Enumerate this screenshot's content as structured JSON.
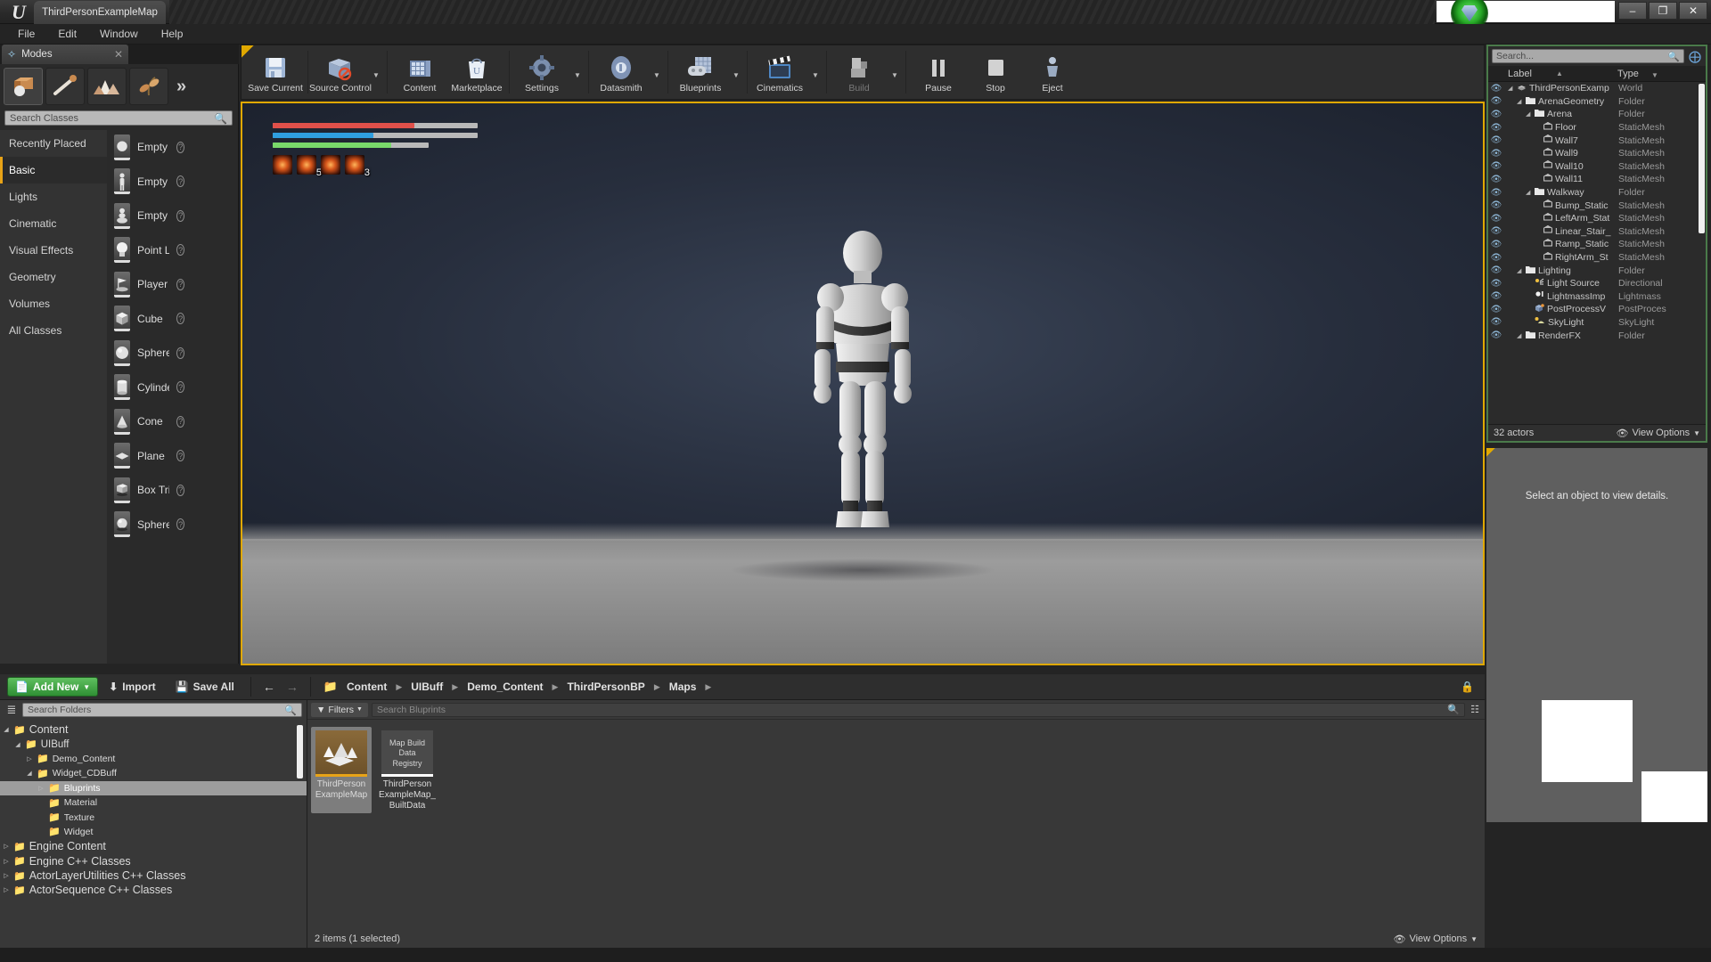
{
  "window": {
    "title": "ThirdPersonExampleMap",
    "logo_icon": "unreal-logo-icon",
    "minimize_label": "–",
    "maximize_label": "❐",
    "close_label": "✕"
  },
  "menubar": {
    "items": [
      "File",
      "Edit",
      "Window",
      "Help"
    ]
  },
  "modes": {
    "tab_label": "Modes",
    "tab_icon": "modes-icon",
    "close_label": "✕",
    "more_label": "»",
    "mode_icons": [
      "place-mode-icon",
      "paint-mode-icon",
      "landscape-mode-icon",
      "foliage-mode-icon"
    ],
    "search_placeholder": "Search Classes",
    "search_icon": "search-icon",
    "categories": [
      "Recently Placed",
      "Basic",
      "Lights",
      "Cinematic",
      "Visual Effects",
      "Geometry",
      "Volumes",
      "All Classes"
    ],
    "active_category": "Basic",
    "classes": [
      {
        "label": "Empty Acto",
        "icon": "empty-actor-icon"
      },
      {
        "label": "Empty Char",
        "icon": "empty-character-icon"
      },
      {
        "label": "Empty Paw",
        "icon": "empty-pawn-icon"
      },
      {
        "label": "Point Light",
        "icon": "point-light-icon"
      },
      {
        "label": "Player Star",
        "icon": "player-start-icon"
      },
      {
        "label": "Cube",
        "icon": "cube-icon"
      },
      {
        "label": "Sphere",
        "icon": "sphere-icon"
      },
      {
        "label": "Cylinder",
        "icon": "cylinder-icon"
      },
      {
        "label": "Cone",
        "icon": "cone-icon"
      },
      {
        "label": "Plane",
        "icon": "plane-icon"
      },
      {
        "label": "Box Trigger",
        "icon": "box-trigger-icon"
      },
      {
        "label": "Sphere Trig",
        "icon": "sphere-trigger-icon"
      }
    ],
    "help_label": "?"
  },
  "toolbar": {
    "buttons": [
      {
        "label": "Save Current",
        "icon": "save-icon",
        "caret": false,
        "disabled": false
      },
      {
        "label": "Source Control",
        "icon": "source-control-icon",
        "caret": true,
        "disabled": false
      },
      {
        "label": "Content",
        "icon": "content-icon",
        "caret": false,
        "disabled": false
      },
      {
        "label": "Marketplace",
        "icon": "marketplace-icon",
        "caret": false,
        "disabled": false
      },
      {
        "label": "Settings",
        "icon": "settings-gear-icon",
        "caret": true,
        "disabled": false
      },
      {
        "label": "Datasmith",
        "icon": "datasmith-icon",
        "caret": true,
        "disabled": false
      },
      {
        "label": "Blueprints",
        "icon": "blueprints-icon",
        "caret": true,
        "disabled": false
      },
      {
        "label": "Cinematics",
        "icon": "cinematics-icon",
        "caret": true,
        "disabled": false
      },
      {
        "label": "Build",
        "icon": "build-icon",
        "caret": true,
        "disabled": true
      },
      {
        "label": "Pause",
        "icon": "pause-icon",
        "caret": false,
        "disabled": false
      },
      {
        "label": "Stop",
        "icon": "stop-icon",
        "caret": false,
        "disabled": false
      },
      {
        "label": "Eject",
        "icon": "eject-icon",
        "caret": false,
        "disabled": false
      }
    ]
  },
  "viewport": {
    "hud": {
      "bars": [
        {
          "name": "health",
          "color": "#e0504a",
          "percent": 69
        },
        {
          "name": "mana",
          "color": "#2f9fe0",
          "percent": 49
        },
        {
          "name": "stamina",
          "color": "#79d96a",
          "percent": 58,
          "track_width": 76
        }
      ],
      "abilities": [
        {
          "icon": "ability-icon-1",
          "count": ""
        },
        {
          "icon": "ability-icon-2",
          "count": "5"
        },
        {
          "icon": "ability-icon-3",
          "count": ""
        },
        {
          "icon": "ability-icon-4",
          "count": "3"
        }
      ]
    },
    "character": "third-person-mannequin"
  },
  "outliner": {
    "search_placeholder": "Search...",
    "search_icon": "search-icon",
    "add_icon": "add-actor-icon",
    "columns": [
      "Label",
      "Type"
    ],
    "rows": [
      {
        "label": "ThirdPersonExamp",
        "type": "World",
        "indent": 0,
        "icon": "world-icon",
        "arrow": true
      },
      {
        "label": "ArenaGeometry",
        "type": "Folder",
        "indent": 1,
        "icon": "folder-icon",
        "arrow": true
      },
      {
        "label": "Arena",
        "type": "Folder",
        "indent": 2,
        "icon": "folder-icon",
        "arrow": true
      },
      {
        "label": "Floor",
        "type": "StaticMesh",
        "indent": 3,
        "icon": "mesh-icon",
        "arrow": false
      },
      {
        "label": "Wall7",
        "type": "StaticMesh",
        "indent": 3,
        "icon": "mesh-icon",
        "arrow": false
      },
      {
        "label": "Wall9",
        "type": "StaticMesh",
        "indent": 3,
        "icon": "mesh-icon",
        "arrow": false
      },
      {
        "label": "Wall10",
        "type": "StaticMesh",
        "indent": 3,
        "icon": "mesh-icon",
        "arrow": false
      },
      {
        "label": "Wall11",
        "type": "StaticMesh",
        "indent": 3,
        "icon": "mesh-icon",
        "arrow": false
      },
      {
        "label": "Walkway",
        "type": "Folder",
        "indent": 2,
        "icon": "folder-icon",
        "arrow": true
      },
      {
        "label": "Bump_Static",
        "type": "StaticMesh",
        "indent": 3,
        "icon": "mesh-icon",
        "arrow": false
      },
      {
        "label": "LeftArm_Stat",
        "type": "StaticMesh",
        "indent": 3,
        "icon": "mesh-icon",
        "arrow": false
      },
      {
        "label": "Linear_Stair_",
        "type": "StaticMesh",
        "indent": 3,
        "icon": "mesh-icon",
        "arrow": false
      },
      {
        "label": "Ramp_Static",
        "type": "StaticMesh",
        "indent": 3,
        "icon": "mesh-icon",
        "arrow": false
      },
      {
        "label": "RightArm_St",
        "type": "StaticMesh",
        "indent": 3,
        "icon": "mesh-icon",
        "arrow": false
      },
      {
        "label": "Lighting",
        "type": "Folder",
        "indent": 1,
        "icon": "folder-icon",
        "arrow": true
      },
      {
        "label": "Light Source",
        "type": "Directional",
        "indent": 2,
        "icon": "directional-light-icon",
        "arrow": false
      },
      {
        "label": "LightmassImp",
        "type": "Lightmass",
        "indent": 2,
        "icon": "lightmass-icon",
        "arrow": false
      },
      {
        "label": "PostProcessV",
        "type": "PostProces",
        "indent": 2,
        "icon": "postprocess-icon",
        "arrow": false
      },
      {
        "label": "SkyLight",
        "type": "SkyLight",
        "indent": 2,
        "icon": "skylight-icon",
        "arrow": false
      },
      {
        "label": "RenderFX",
        "type": "Folder",
        "indent": 1,
        "icon": "folder-icon",
        "arrow": true
      }
    ],
    "actor_count": "32 actors",
    "view_options": "View Options",
    "view_options_icon": "eye-icon"
  },
  "details": {
    "empty_message": "Select an object to view details."
  },
  "content_browser": {
    "add_new": "Add New",
    "add_new_icon": "new-asset-icon",
    "import": "Import",
    "import_icon": "import-icon",
    "save_all": "Save All",
    "save_all_icon": "save-icon",
    "back_icon": "←",
    "forward_icon": "→",
    "folder_icon": "folder-open-icon",
    "breadcrumbs": [
      "Content",
      "UIBuff",
      "Demo_Content",
      "ThirdPersonBP",
      "Maps"
    ],
    "lock_icon": "lock-icon",
    "folder_search_placeholder": "Search Folders",
    "folder_search_icon": "search-icon",
    "collapse_icon": "collapse-tree-icon",
    "tree": [
      {
        "label": "Content",
        "indent": 0,
        "arrow": "◢",
        "size": "big",
        "selected": false
      },
      {
        "label": "UIBuff",
        "indent": 1,
        "arrow": "◢",
        "size": "mid",
        "selected": false
      },
      {
        "label": "Demo_Content",
        "indent": 2,
        "arrow": "▷",
        "size": "small",
        "selected": false
      },
      {
        "label": "Widget_CDBuff",
        "indent": 2,
        "arrow": "◢",
        "size": "small",
        "selected": false
      },
      {
        "label": "Bluprints",
        "indent": 3,
        "arrow": "▷",
        "size": "small",
        "selected": true
      },
      {
        "label": "Material",
        "indent": 3,
        "arrow": "",
        "size": "small",
        "selected": false
      },
      {
        "label": "Texture",
        "indent": 3,
        "arrow": "",
        "size": "small",
        "selected": false
      },
      {
        "label": "Widget",
        "indent": 3,
        "arrow": "",
        "size": "small",
        "selected": false
      },
      {
        "label": "Engine Content",
        "indent": 0,
        "arrow": "▷",
        "size": "big",
        "selected": false
      },
      {
        "label": "Engine C++ Classes",
        "indent": 0,
        "arrow": "▷",
        "size": "big",
        "selected": false
      },
      {
        "label": "ActorLayerUtilities C++ Classes",
        "indent": 0,
        "arrow": "▷",
        "size": "big",
        "selected": false
      },
      {
        "label": "ActorSequence C++ Classes",
        "indent": 0,
        "arrow": "▷",
        "size": "big",
        "selected": false
      }
    ],
    "filters_label": "Filters",
    "filters_icon": "filter-icon",
    "asset_search_placeholder": "Search Bluprints",
    "asset_search_icon": "search-icon",
    "grid_icon": "grid-view-icon",
    "assets": [
      {
        "name": "ThirdPerson\nExampleMap",
        "thumb_type": "map",
        "thumb_text": "",
        "selected": true
      },
      {
        "name": "ThirdPerson\nExampleMap_\nBuiltData",
        "thumb_type": "registry",
        "thumb_text": "Map Build\nData Registry",
        "selected": false
      }
    ],
    "status": "2 items (1 selected)",
    "view_options": "View Options",
    "view_options_icon": "eye-icon"
  }
}
